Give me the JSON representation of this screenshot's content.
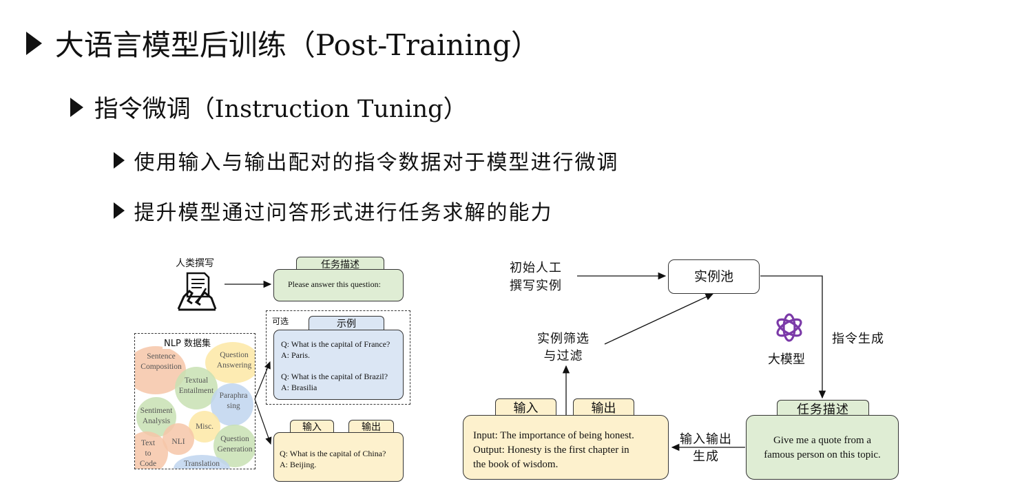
{
  "heading": {
    "title": "大语言模型后训练（Post-Training）",
    "sub": "指令微调（Instruction Tuning）",
    "points": [
      "使用输入与输出配对的指令数据对于模型进行微调",
      "提升模型通过问答形式进行任务求解的能力"
    ]
  },
  "left_diagram": {
    "human_label": "人类撰写",
    "task_tab": "任务描述",
    "task_text": "Please answer this question:",
    "optional_label": "可选",
    "example_tab": "示例",
    "example_lines": [
      "Q: What is the capital of France?",
      "A: Paris.",
      "Q: What is the capital of Brazil?",
      "A: Brasilia"
    ],
    "nlp_title": "NLP 数据集",
    "tasks": [
      "Sentence Composition",
      "Question Answering",
      "Textual Entailment",
      "Paraphra sing",
      "Sentiment Analysis",
      "Misc.",
      "NLI",
      "Question Generation",
      "Text to Code",
      "Translation"
    ],
    "input_tab": "输入",
    "output_tab": "输出",
    "qa_lines": [
      "Q: What is the capital of China?",
      "A: Beijing."
    ]
  },
  "right_diagram": {
    "seed_label": [
      "初始人工",
      "撰写实例"
    ],
    "pool_label": "实例池",
    "model_label": "大模型",
    "instruct_gen": "指令生成",
    "task_tab": "任务描述",
    "task_text": [
      "Give me a quote from a",
      "famous person on this topic."
    ],
    "io_gen": [
      "输入输出",
      "生成"
    ],
    "filter_label": [
      "实例筛选",
      "与过滤"
    ],
    "input_tab": "输入",
    "output_tab": "输出",
    "io_text": [
      "Input: The importance of being honest.",
      "Output: Honesty is the first chapter in",
      "the book of wisdom."
    ]
  },
  "colors": {
    "task_green": "#dfedd4",
    "example_blue": "#dbe6f4",
    "io_yellow": "#fdf1cd"
  }
}
